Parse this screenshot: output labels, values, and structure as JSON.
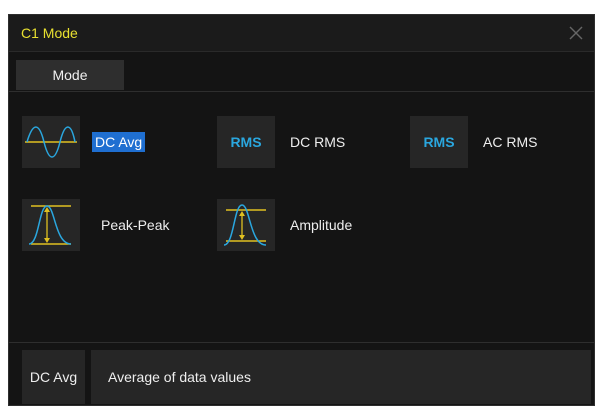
{
  "dialog": {
    "title": "C1 Mode",
    "close_icon": "close-icon"
  },
  "tabs": [
    {
      "label": "Mode"
    }
  ],
  "options": [
    {
      "label": "DC Avg",
      "icon": "sine-wave-icon",
      "selected": true
    },
    {
      "label": "DC RMS",
      "icon_text": "RMS"
    },
    {
      "label": "AC RMS",
      "icon_text": "RMS"
    },
    {
      "label": "Peak-Peak",
      "icon": "peak-peak-icon"
    },
    {
      "label": "Amplitude",
      "icon": "amplitude-icon"
    }
  ],
  "description": {
    "key": "DC Avg",
    "text": "Average of data values"
  },
  "colors": {
    "title": "#e8e030",
    "rms": "#2aa7df",
    "selected": "#1f6fd1",
    "wave": "#2aa7df",
    "marker": "#e0c020"
  }
}
